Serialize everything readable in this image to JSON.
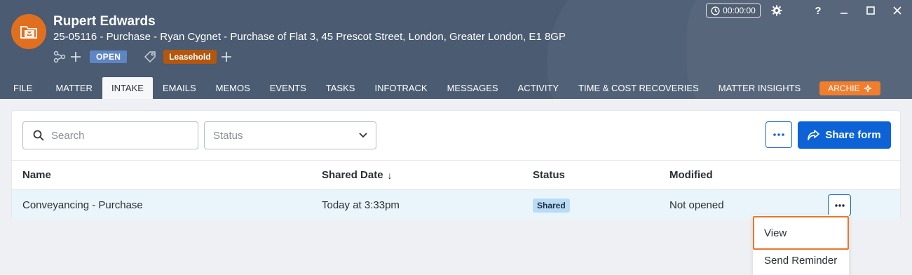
{
  "header": {
    "client_name": "Rupert Edwards",
    "matter_description": "25-05116 - Purchase - Ryan Cygnet - Purchase of Flat 3, 45 Prescot Street, London, Greater London, E1 8GP",
    "status_badge": "OPEN",
    "tag": "Leasehold",
    "timer": "00:00:00",
    "help_label": "?",
    "accent_color": "#e0701f",
    "header_color": "#4a5b72"
  },
  "tabs": [
    {
      "label": "FILE"
    },
    {
      "label": "MATTER"
    },
    {
      "label": "INTAKE",
      "active": true
    },
    {
      "label": "EMAILS"
    },
    {
      "label": "MEMOS"
    },
    {
      "label": "EVENTS"
    },
    {
      "label": "TASKS"
    },
    {
      "label": "INFOTRACK"
    },
    {
      "label": "MESSAGES"
    },
    {
      "label": "ACTIVITY"
    },
    {
      "label": "TIME & COST RECOVERIES"
    },
    {
      "label": "MATTER INSIGHTS"
    }
  ],
  "archie_label": "ARCHIE",
  "toolbar": {
    "search_placeholder": "Search",
    "status_placeholder": "Status",
    "share_label": "Share form"
  },
  "table": {
    "columns": [
      "Name",
      "Shared Date",
      "Status",
      "Modified"
    ],
    "sort_indicator": "↓",
    "rows": [
      {
        "name": "Conveyancing - Purchase",
        "shared_date": "Today at 3:33pm",
        "status": "Shared",
        "modified": "Not opened"
      }
    ]
  },
  "row_menu": {
    "items": [
      "View",
      "Send Reminder"
    ]
  }
}
